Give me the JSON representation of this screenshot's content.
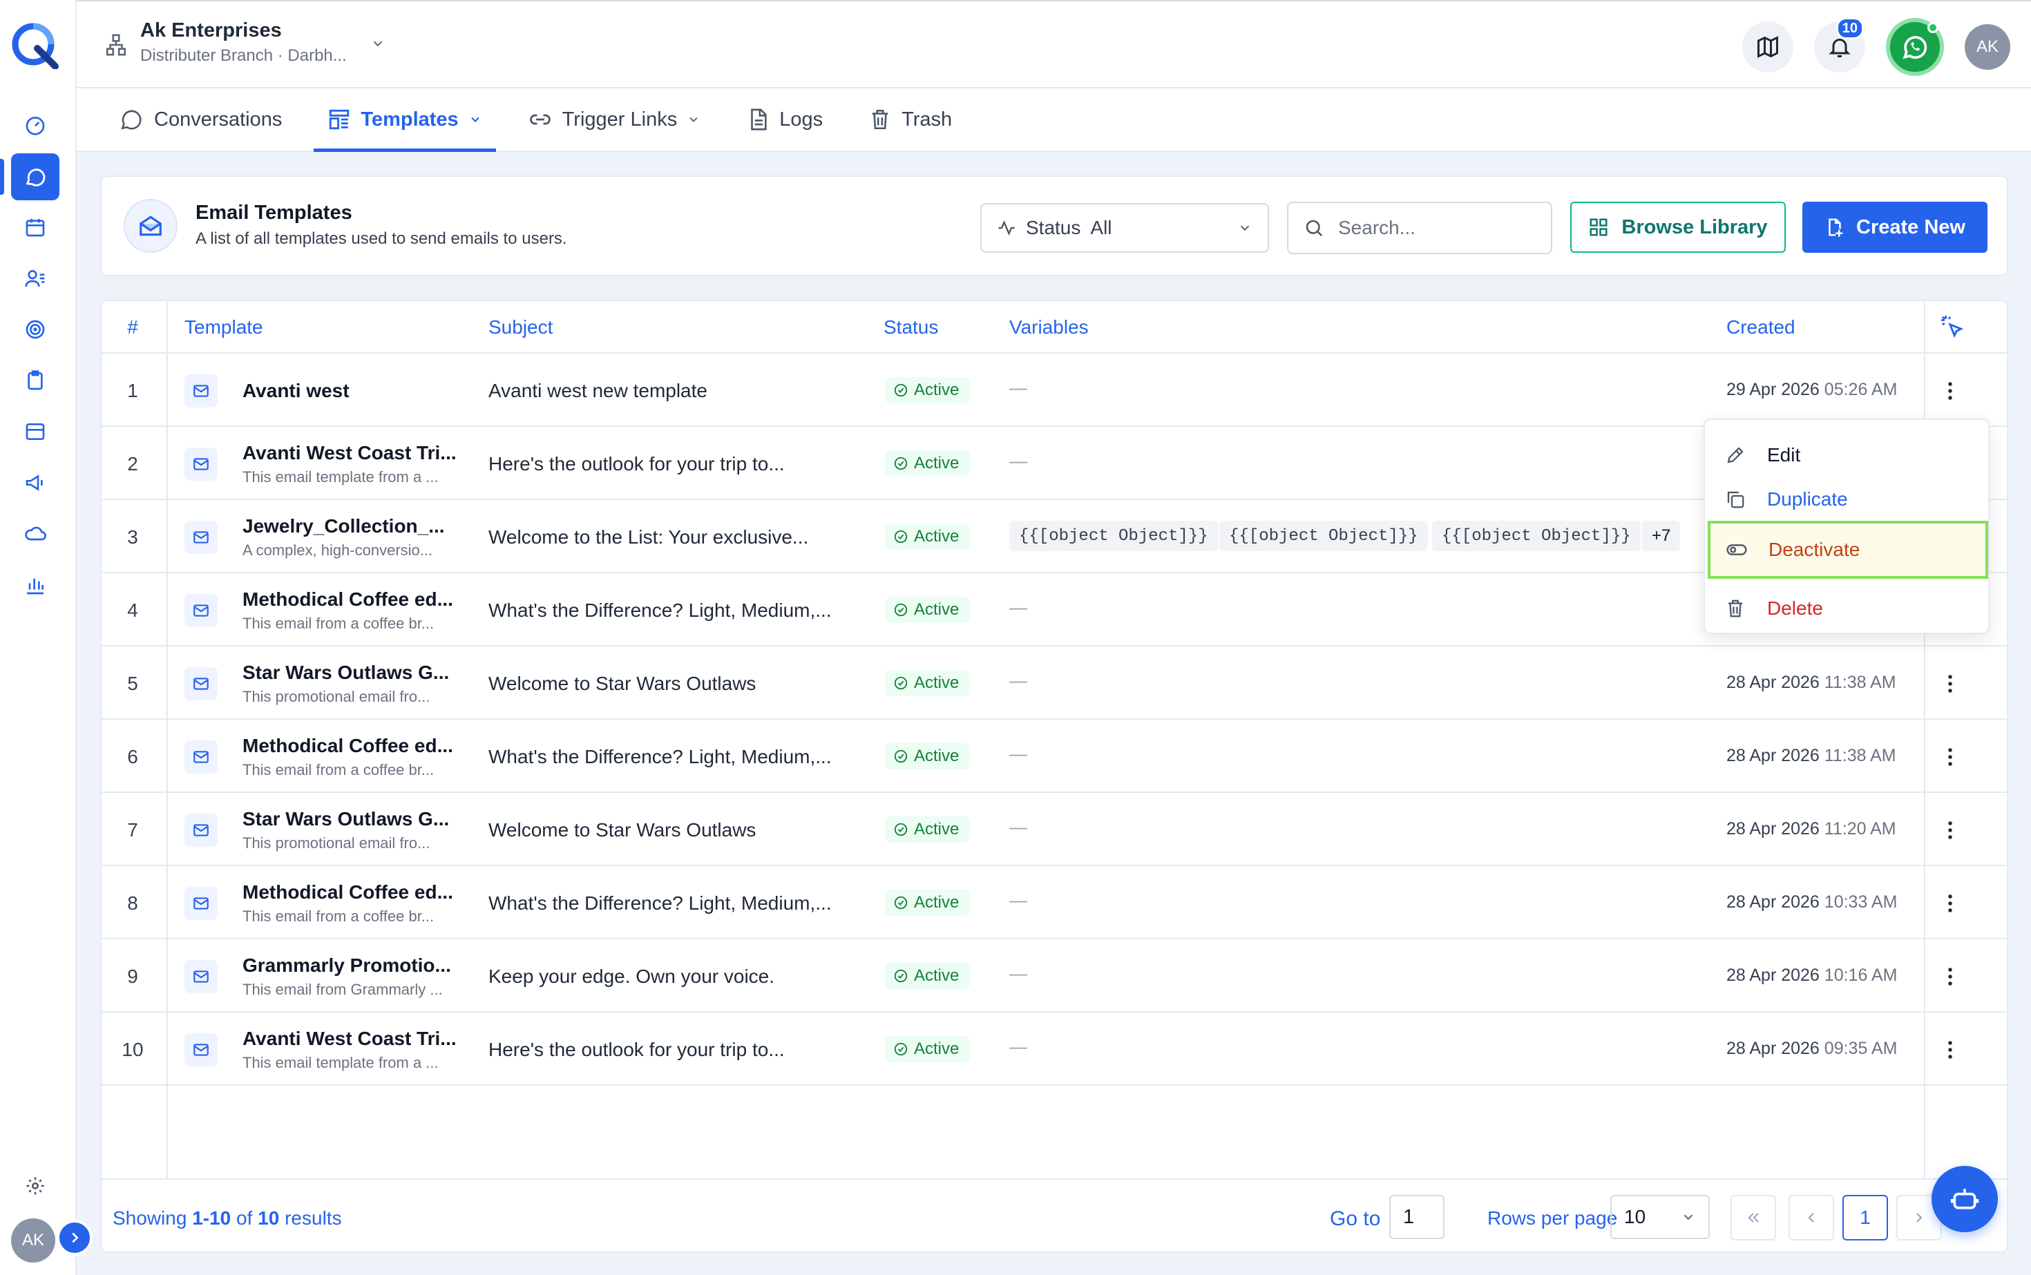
{
  "org": {
    "name": "Ak Enterprises",
    "branch": "Distributer Branch · Darbh..."
  },
  "top": {
    "notifications": "10",
    "avatar": "AK"
  },
  "rail": {
    "avatar": "AK"
  },
  "tabs": [
    {
      "label": "Conversations",
      "icon": "chat-bubble-icon"
    },
    {
      "label": "Templates",
      "icon": "templates-icon"
    },
    {
      "label": "Trigger Links",
      "icon": "link-icon"
    },
    {
      "label": "Logs",
      "icon": "document-icon"
    },
    {
      "label": "Trash",
      "icon": "trash-icon"
    }
  ],
  "header": {
    "title": "Email Templates",
    "subtitle": "A list of all templates used to send emails to users.",
    "status_label": "Status",
    "status_value": "All",
    "search_placeholder": "Search...",
    "browse_label": "Browse Library",
    "create_label": "Create New"
  },
  "table": {
    "columns": {
      "num": "#",
      "template": "Template",
      "subject": "Subject",
      "status": "Status",
      "variables": "Variables",
      "created": "Created"
    },
    "rows": [
      {
        "num": "1",
        "name": "Avanti west",
        "desc": "",
        "subject": "Avanti west new template",
        "status": "Active",
        "vars": "—",
        "date": "29 Apr 2026",
        "time": "05:26 AM"
      },
      {
        "num": "2",
        "name": "Avanti West Coast Tri...",
        "desc": "This email template from a ...",
        "subject": "Here's the outlook for your trip to...",
        "status": "Active",
        "vars": "—",
        "date": "",
        "time": ""
      },
      {
        "num": "3",
        "name": "Jewelry_Collection_...",
        "desc": "A complex, high-conversio...",
        "subject": "Welcome to the List: Your exclusive...",
        "status": "Active",
        "vars": "",
        "date": "",
        "time": ""
      },
      {
        "num": "4",
        "name": "Methodical Coffee ed...",
        "desc": "This email from a coffee br...",
        "subject": "What's the Difference? Light, Medium,...",
        "status": "Active",
        "vars": "—",
        "date": "",
        "time": ""
      },
      {
        "num": "5",
        "name": "Star Wars Outlaws G...",
        "desc": "This promotional email fro...",
        "subject": "Welcome to Star Wars Outlaws",
        "status": "Active",
        "vars": "—",
        "date": "28 Apr 2026",
        "time": "11:38 AM"
      },
      {
        "num": "6",
        "name": "Methodical Coffee ed...",
        "desc": "This email from a coffee br...",
        "subject": "What's the Difference? Light, Medium,...",
        "status": "Active",
        "vars": "—",
        "date": "28 Apr 2026",
        "time": "11:38 AM"
      },
      {
        "num": "7",
        "name": "Star Wars Outlaws G...",
        "desc": "This promotional email fro...",
        "subject": "Welcome to Star Wars Outlaws",
        "status": "Active",
        "vars": "—",
        "date": "28 Apr 2026",
        "time": "11:20 AM"
      },
      {
        "num": "8",
        "name": "Methodical Coffee ed...",
        "desc": "This email from a coffee br...",
        "subject": "What's the Difference? Light, Medium,...",
        "status": "Active",
        "vars": "—",
        "date": "28 Apr 2026",
        "time": "10:33 AM"
      },
      {
        "num": "9",
        "name": "Grammarly Promotio...",
        "desc": "This email from Grammarly ...",
        "subject": "Keep your edge. Own your voice.",
        "status": "Active",
        "vars": "—",
        "date": "28 Apr 2026",
        "time": "10:16 AM"
      },
      {
        "num": "10",
        "name": "Avanti West Coast Tri...",
        "desc": "This email template from a ...",
        "subject": "Here's the outlook for your trip to...",
        "status": "Active",
        "vars": "—",
        "date": "28 Apr 2026",
        "time": "09:35 AM"
      }
    ],
    "var_chips": [
      "{{[object Object]}}",
      "{{[object Object]}}",
      "{{[object Object]}}"
    ],
    "var_more": "+7"
  },
  "menu": {
    "edit": "Edit",
    "duplicate": "Duplicate",
    "deactivate": "Deactivate",
    "delete": "Delete"
  },
  "footer": {
    "showing_prefix": "Showing",
    "range": "1-10",
    "of": "of",
    "total": "10",
    "suffix": "results",
    "goto_label": "Go to",
    "goto_value": "1",
    "rows_label": "Rows per page",
    "rows_value": "10",
    "current_page": "1"
  },
  "colors": {
    "accent": "#2563eb",
    "success": "#15803d",
    "danger": "#dc2626",
    "warning": "#c2410c",
    "whatsapp": "#16a34a"
  }
}
